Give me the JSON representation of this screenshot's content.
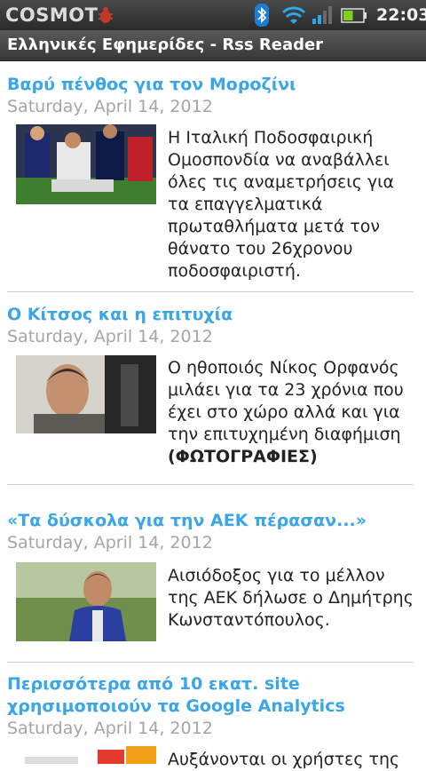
{
  "status_bar": {
    "carrier": "COSMOT",
    "time": "22:03",
    "icons": [
      "debug-bug-icon",
      "bluetooth-icon",
      "wifi-icon",
      "signal-icon",
      "battery-icon"
    ],
    "battery_level": 0.5
  },
  "app": {
    "title": "Ελληνικές Εφημερίδες - Rss Reader"
  },
  "articles": [
    {
      "title": "Βαρύ πένθος για τον Μοροζίνι",
      "date": "Saturday, April 14, 2012",
      "text": "Η Ιταλική Ποδοσφαιρική Ομοσπονδία να αναβάλλει όλες τις αναμετρήσεις για τα επαγγελματικά πρωταθλήματα μετά τον θάνατο του 26χρονου ποδοσφαιριστή.",
      "image": "football-medics-photo"
    },
    {
      "title": "Ο Κίτσος και η επιτυχία",
      "date": "Saturday, April 14, 2012",
      "text": "Ο ηθοποιός Νίκος Ορφανός μιλάει για τα 23 χρόνια που έχει στο χώρο αλλά και για την επιτυχημένη διαφήμιση",
      "text_bold": "(ΦΩΤΟΓΡΑΦΙΕΣ)",
      "image": "actor-portrait-photo"
    },
    {
      "title": "«Τα δύσκολα για την ΑΕΚ πέρασαν...»",
      "date": "Saturday, April 14, 2012",
      "text": "Αισιόδοξος για το μέλλον της ΑΕΚ δήλωσε ο Δημήτρης Κωνσταντόπουλος.",
      "image": "coach-photo"
    },
    {
      "title": "Περισσότερα από 10 εκατ. site χρησιμοποιούν τα Google Analytics",
      "date": "Saturday, April 14, 2012",
      "text": "Αυξάνονται οι χρήστες της",
      "image": "analytics-logo-photo"
    }
  ]
}
